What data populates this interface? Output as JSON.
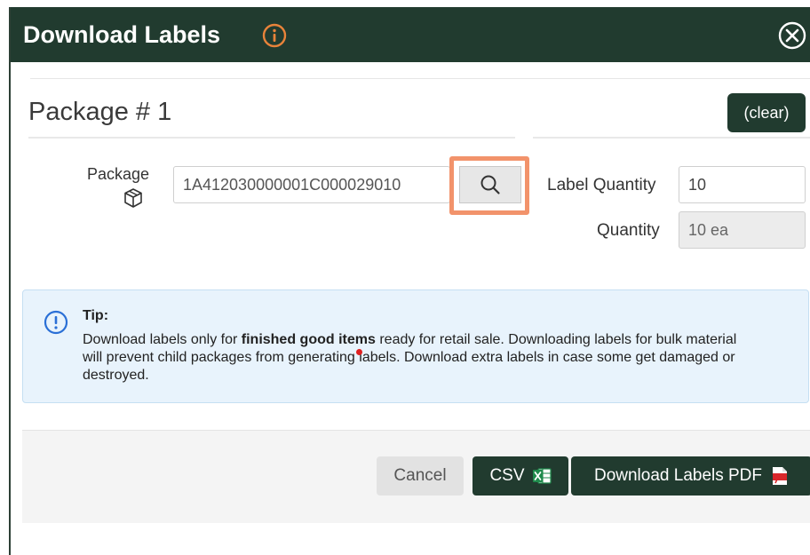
{
  "dialog": {
    "title": "Download Labels"
  },
  "package_section": {
    "title": "Package # 1",
    "clear_label": "(clear)",
    "package_label": "Package",
    "package_value": "1A412030000001C000029010",
    "label_quantity_label": "Label Quantity",
    "label_quantity_value": "10",
    "quantity_label": "Quantity",
    "quantity_value": "10 ea"
  },
  "tip": {
    "title": "Tip:",
    "text_before": "Download labels only for ",
    "text_bold": "finished good items",
    "text_after": " ready for retail sale. Downloading labels for bulk material will prevent child packages from generating labels. Download extra labels in case some get damaged or destroyed."
  },
  "footer": {
    "cancel_label": "Cancel",
    "csv_label": "CSV",
    "pdf_label": "Download Labels PDF"
  },
  "icons": {
    "info": "info-circle-icon",
    "close": "close-circle-icon",
    "package": "box-icon",
    "search": "search-icon",
    "excel": "excel-icon",
    "pdf": "pdf-icon"
  },
  "colors": {
    "brand_dark_green": "#213b2f",
    "info_orange": "#e8833a",
    "highlight_orange": "#f2936b",
    "tip_background": "#e8f3fc",
    "tip_icon_blue": "#2a6fd6",
    "excel_green": "#1f8a4c",
    "pdf_red": "#d9262a"
  }
}
